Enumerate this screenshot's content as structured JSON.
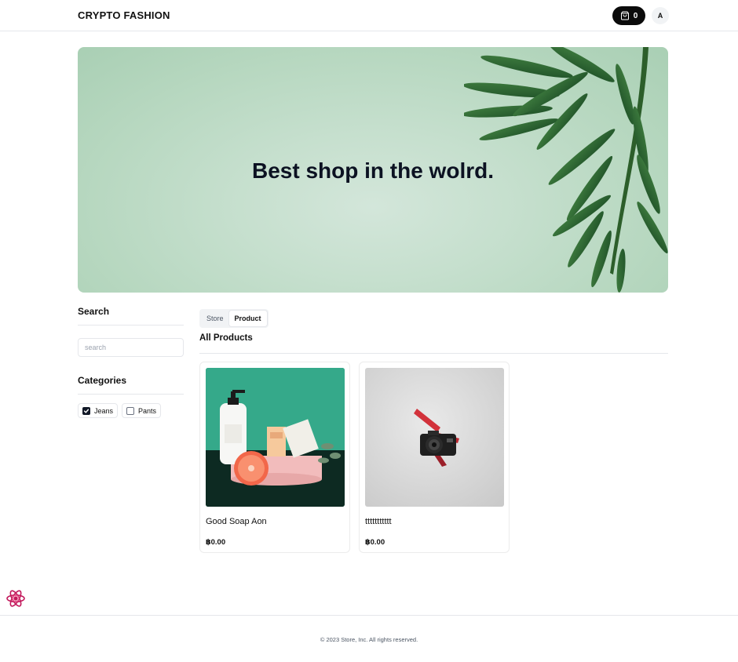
{
  "header": {
    "brand": "CRYPTO FASHION",
    "cart_count": "0",
    "cart_icon": "shopping-bag-icon",
    "avatar_initial": "A"
  },
  "hero": {
    "title": "Best shop in the wolrd."
  },
  "sidebar": {
    "search_heading": "Search",
    "search_placeholder": "search",
    "search_value": "",
    "categories_heading": "Categories",
    "categories": [
      {
        "label": "Jeans",
        "checked": true
      },
      {
        "label": "Pants",
        "checked": false
      }
    ]
  },
  "main": {
    "tabs": [
      {
        "label": "Store",
        "active": false
      },
      {
        "label": "Product",
        "active": true
      }
    ],
    "section_title": "All Products",
    "products": [
      {
        "name": "Good Soap Aon",
        "price": "฿0.00"
      },
      {
        "name": "ttttttttttt",
        "price": "฿0.00"
      }
    ]
  },
  "footer": {
    "copyright": "© 2023 Store, Inc. All rights reserved."
  },
  "colors": {
    "hero_bg": "#c5dfcd",
    "cart_bg": "#0b0b0b",
    "soap_bg": "#2b9a7c"
  }
}
